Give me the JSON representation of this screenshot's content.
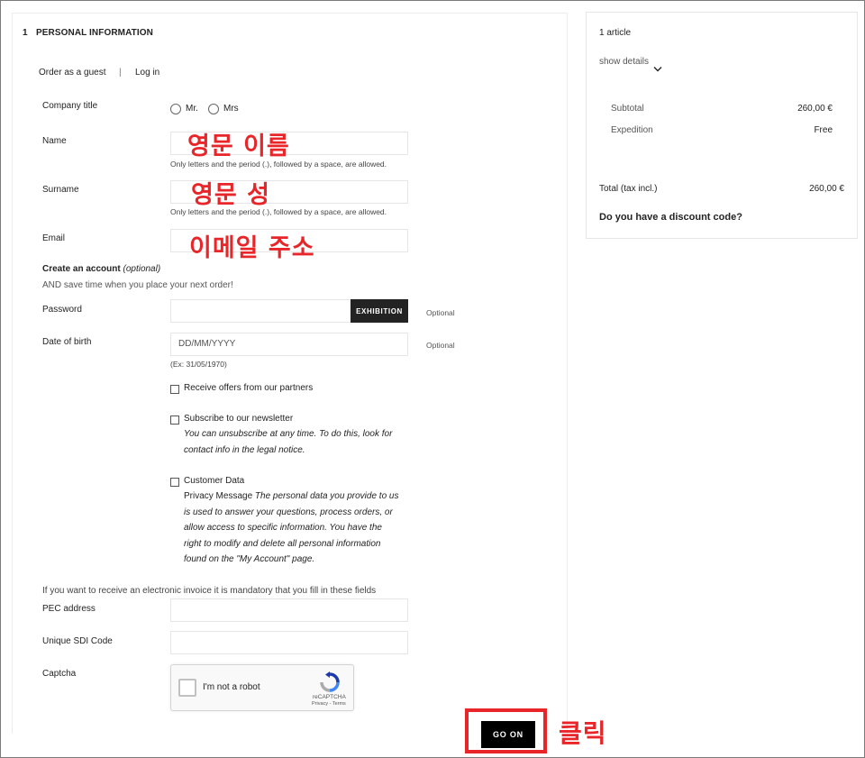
{
  "personal_info": {
    "step_number": "1",
    "step_title": "PERSONAL INFORMATION",
    "order_as_guest": "Order as a guest",
    "separator": "|",
    "log_in": "Log in",
    "company_title_label": "Company title",
    "title_options": [
      "Mr.",
      "Mrs"
    ],
    "name_label": "Name",
    "name_hint": "Only letters and the period (.), followed by a space, are allowed.",
    "surname_label": "Surname",
    "surname_hint": "Only letters and the period (.), followed by a space, are allowed.",
    "email_label": "Email",
    "create_account_label": "Create an account",
    "create_account_optional": "(optional)",
    "create_account_sub": "AND save time when you place your next order!",
    "password_label": "Password",
    "password_button": "EXHIBITION",
    "password_optional": "Optional",
    "dob_label": "Date of birth",
    "dob_placeholder": "DD/MM/YYYY",
    "dob_optional": "Optional",
    "dob_example": "(Ex: 31/05/1970)",
    "offers_label": "Receive offers from our partners",
    "newsletter_label": "Subscribe to our newsletter",
    "newsletter_note_line1": "You can unsubscribe at any time. To do this, look for",
    "newsletter_note_line2": "contact info in the legal notice.",
    "customer_data_label": "Customer Data",
    "privacy_prefix": "Privacy Message",
    "privacy_line1": "The personal data you provide to us",
    "privacy_line2": "is used to answer your questions, process orders, or",
    "privacy_line3": "allow access to specific information. You have the",
    "privacy_line4": "right to modify and delete all personal information",
    "privacy_line5": "found on the \"My Account\" page.",
    "einvoice_note": "If you want to receive an electronic invoice it is mandatory that you fill in these fields",
    "pec_label": "PEC address",
    "sdi_label": "Unique SDI Code",
    "captcha_label": "Captcha",
    "captcha_text": "I'm not a robot",
    "recaptcha_brand": "reCAPTCHA",
    "recaptcha_links": "Privacy - Terms",
    "go_on_button": "GO ON"
  },
  "annotations": {
    "name_overlay": "영문 이름",
    "surname_overlay": "영문 성",
    "email_overlay": "이메일 주소",
    "click_overlay": "클릭",
    "accent_color": "#e8262a"
  },
  "cart_summary": {
    "article_count": "1 article",
    "show_details": "show details",
    "subtotal_label": "Subtotal",
    "subtotal_value": "260,00 €",
    "expedition_label": "Expedition",
    "expedition_value": "Free",
    "total_label": "Total (tax incl.)",
    "total_value": "260,00 €",
    "discount_prompt": "Do you have a discount code?"
  }
}
